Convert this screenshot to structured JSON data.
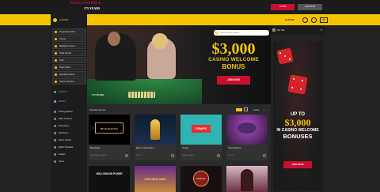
{
  "header": {
    "logo_line1": "WILLIAM HILL",
    "logo_line2": "175 YEARS",
    "close_label": "CLOSE",
    "join_label": "JOIN NOW"
  },
  "nav": {
    "casino_tab": "CASINO",
    "time": "12:07 WS",
    "currency": "GBP"
  },
  "sidebar": {
    "items": [
      {
        "label": "Progressive Wins",
        "style": "boxed"
      },
      {
        "label": "Casino",
        "style": "boxed"
      },
      {
        "label": "Blackjack Games",
        "style": "boxed"
      },
      {
        "label": "Table Games",
        "style": "boxed"
      },
      {
        "label": "Slots",
        "style": "boxed"
      },
      {
        "label": "Video Poker",
        "style": "boxed"
      },
      {
        "label": "Specialty Games",
        "style": "boxed"
      },
      {
        "label": "Recent Winners",
        "style": "boxed"
      },
      {
        "label": "SPORTS",
        "style": "green"
      },
      {
        "label": "VEGAS",
        "style": "blue"
      },
      {
        "label": "Getting Started",
        "style": "plain"
      },
      {
        "label": "Refer A Friend",
        "style": "plain"
      },
      {
        "label": "Promotions",
        "style": "plain"
      },
      {
        "label": "Red Room",
        "style": "plain"
      },
      {
        "label": "Sports Insider",
        "style": "plain"
      },
      {
        "label": "Match Previews",
        "style": "plain"
      },
      {
        "label": "Articles",
        "style": "plain"
      },
      {
        "label": "About",
        "style": "plain"
      }
    ]
  },
  "hero": {
    "search_placeholder": "Search Casino Games",
    "badge": "175 YEARS",
    "amount": "$3,000",
    "line1": "CASINO WELCOME",
    "line2": "BONUS",
    "join_label": "JOIN NOW"
  },
  "popular": {
    "title": "Popular Games",
    "cards_label": "Cards",
    "arrows": "‹ ›",
    "games": [
      {
        "name": "Blackjack",
        "meta": "BLACKJACK GAMES",
        "art_text": "BLACKJACK"
      },
      {
        "name": "Rise of Poseidon",
        "meta": "SLOTS",
        "art_text": ""
      },
      {
        "name": "Craps",
        "meta": "TABLE GAMES",
        "art_text": "CRAPS"
      },
      {
        "name": "Thunderbird",
        "meta": "SLOTS",
        "art_text": ""
      }
    ],
    "row2": [
      {
        "art_text": "HOLLYWOOD POKER"
      },
      {
        "art_text": "GOLDEN SUN"
      },
      {
        "art_text": "KNIGHT"
      },
      {
        "art_text": ""
      }
    ]
  },
  "betslip": {
    "label": "Bet Slip",
    "close": "✕"
  },
  "side_ad": {
    "upto": "UP TO",
    "amount": "$3,000",
    "line1": "IN CASINO WELCOME",
    "line2": "BONUSES",
    "join_label": "JOIN NOW"
  }
}
